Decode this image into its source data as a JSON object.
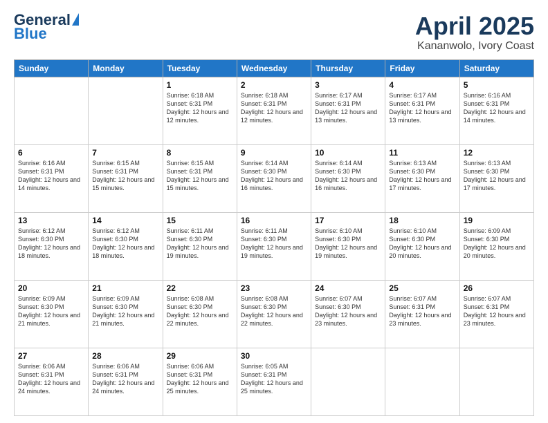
{
  "header": {
    "logo_general": "General",
    "logo_blue": "Blue",
    "title": "April 2025",
    "subtitle": "Kananwolo, Ivory Coast"
  },
  "weekdays": [
    "Sunday",
    "Monday",
    "Tuesday",
    "Wednesday",
    "Thursday",
    "Friday",
    "Saturday"
  ],
  "weeks": [
    [
      {
        "day": "",
        "sunrise": "",
        "sunset": "",
        "daylight": ""
      },
      {
        "day": "",
        "sunrise": "",
        "sunset": "",
        "daylight": ""
      },
      {
        "day": "1",
        "sunrise": "Sunrise: 6:18 AM",
        "sunset": "Sunset: 6:31 PM",
        "daylight": "Daylight: 12 hours and 12 minutes."
      },
      {
        "day": "2",
        "sunrise": "Sunrise: 6:18 AM",
        "sunset": "Sunset: 6:31 PM",
        "daylight": "Daylight: 12 hours and 12 minutes."
      },
      {
        "day": "3",
        "sunrise": "Sunrise: 6:17 AM",
        "sunset": "Sunset: 6:31 PM",
        "daylight": "Daylight: 12 hours and 13 minutes."
      },
      {
        "day": "4",
        "sunrise": "Sunrise: 6:17 AM",
        "sunset": "Sunset: 6:31 PM",
        "daylight": "Daylight: 12 hours and 13 minutes."
      },
      {
        "day": "5",
        "sunrise": "Sunrise: 6:16 AM",
        "sunset": "Sunset: 6:31 PM",
        "daylight": "Daylight: 12 hours and 14 minutes."
      }
    ],
    [
      {
        "day": "6",
        "sunrise": "Sunrise: 6:16 AM",
        "sunset": "Sunset: 6:31 PM",
        "daylight": "Daylight: 12 hours and 14 minutes."
      },
      {
        "day": "7",
        "sunrise": "Sunrise: 6:15 AM",
        "sunset": "Sunset: 6:31 PM",
        "daylight": "Daylight: 12 hours and 15 minutes."
      },
      {
        "day": "8",
        "sunrise": "Sunrise: 6:15 AM",
        "sunset": "Sunset: 6:31 PM",
        "daylight": "Daylight: 12 hours and 15 minutes."
      },
      {
        "day": "9",
        "sunrise": "Sunrise: 6:14 AM",
        "sunset": "Sunset: 6:30 PM",
        "daylight": "Daylight: 12 hours and 16 minutes."
      },
      {
        "day": "10",
        "sunrise": "Sunrise: 6:14 AM",
        "sunset": "Sunset: 6:30 PM",
        "daylight": "Daylight: 12 hours and 16 minutes."
      },
      {
        "day": "11",
        "sunrise": "Sunrise: 6:13 AM",
        "sunset": "Sunset: 6:30 PM",
        "daylight": "Daylight: 12 hours and 17 minutes."
      },
      {
        "day": "12",
        "sunrise": "Sunrise: 6:13 AM",
        "sunset": "Sunset: 6:30 PM",
        "daylight": "Daylight: 12 hours and 17 minutes."
      }
    ],
    [
      {
        "day": "13",
        "sunrise": "Sunrise: 6:12 AM",
        "sunset": "Sunset: 6:30 PM",
        "daylight": "Daylight: 12 hours and 18 minutes."
      },
      {
        "day": "14",
        "sunrise": "Sunrise: 6:12 AM",
        "sunset": "Sunset: 6:30 PM",
        "daylight": "Daylight: 12 hours and 18 minutes."
      },
      {
        "day": "15",
        "sunrise": "Sunrise: 6:11 AM",
        "sunset": "Sunset: 6:30 PM",
        "daylight": "Daylight: 12 hours and 19 minutes."
      },
      {
        "day": "16",
        "sunrise": "Sunrise: 6:11 AM",
        "sunset": "Sunset: 6:30 PM",
        "daylight": "Daylight: 12 hours and 19 minutes."
      },
      {
        "day": "17",
        "sunrise": "Sunrise: 6:10 AM",
        "sunset": "Sunset: 6:30 PM",
        "daylight": "Daylight: 12 hours and 19 minutes."
      },
      {
        "day": "18",
        "sunrise": "Sunrise: 6:10 AM",
        "sunset": "Sunset: 6:30 PM",
        "daylight": "Daylight: 12 hours and 20 minutes."
      },
      {
        "day": "19",
        "sunrise": "Sunrise: 6:09 AM",
        "sunset": "Sunset: 6:30 PM",
        "daylight": "Daylight: 12 hours and 20 minutes."
      }
    ],
    [
      {
        "day": "20",
        "sunrise": "Sunrise: 6:09 AM",
        "sunset": "Sunset: 6:30 PM",
        "daylight": "Daylight: 12 hours and 21 minutes."
      },
      {
        "day": "21",
        "sunrise": "Sunrise: 6:09 AM",
        "sunset": "Sunset: 6:30 PM",
        "daylight": "Daylight: 12 hours and 21 minutes."
      },
      {
        "day": "22",
        "sunrise": "Sunrise: 6:08 AM",
        "sunset": "Sunset: 6:30 PM",
        "daylight": "Daylight: 12 hours and 22 minutes."
      },
      {
        "day": "23",
        "sunrise": "Sunrise: 6:08 AM",
        "sunset": "Sunset: 6:30 PM",
        "daylight": "Daylight: 12 hours and 22 minutes."
      },
      {
        "day": "24",
        "sunrise": "Sunrise: 6:07 AM",
        "sunset": "Sunset: 6:30 PM",
        "daylight": "Daylight: 12 hours and 23 minutes."
      },
      {
        "day": "25",
        "sunrise": "Sunrise: 6:07 AM",
        "sunset": "Sunset: 6:31 PM",
        "daylight": "Daylight: 12 hours and 23 minutes."
      },
      {
        "day": "26",
        "sunrise": "Sunrise: 6:07 AM",
        "sunset": "Sunset: 6:31 PM",
        "daylight": "Daylight: 12 hours and 23 minutes."
      }
    ],
    [
      {
        "day": "27",
        "sunrise": "Sunrise: 6:06 AM",
        "sunset": "Sunset: 6:31 PM",
        "daylight": "Daylight: 12 hours and 24 minutes."
      },
      {
        "day": "28",
        "sunrise": "Sunrise: 6:06 AM",
        "sunset": "Sunset: 6:31 PM",
        "daylight": "Daylight: 12 hours and 24 minutes."
      },
      {
        "day": "29",
        "sunrise": "Sunrise: 6:06 AM",
        "sunset": "Sunset: 6:31 PM",
        "daylight": "Daylight: 12 hours and 25 minutes."
      },
      {
        "day": "30",
        "sunrise": "Sunrise: 6:05 AM",
        "sunset": "Sunset: 6:31 PM",
        "daylight": "Daylight: 12 hours and 25 minutes."
      },
      {
        "day": "",
        "sunrise": "",
        "sunset": "",
        "daylight": ""
      },
      {
        "day": "",
        "sunrise": "",
        "sunset": "",
        "daylight": ""
      },
      {
        "day": "",
        "sunrise": "",
        "sunset": "",
        "daylight": ""
      }
    ]
  ]
}
